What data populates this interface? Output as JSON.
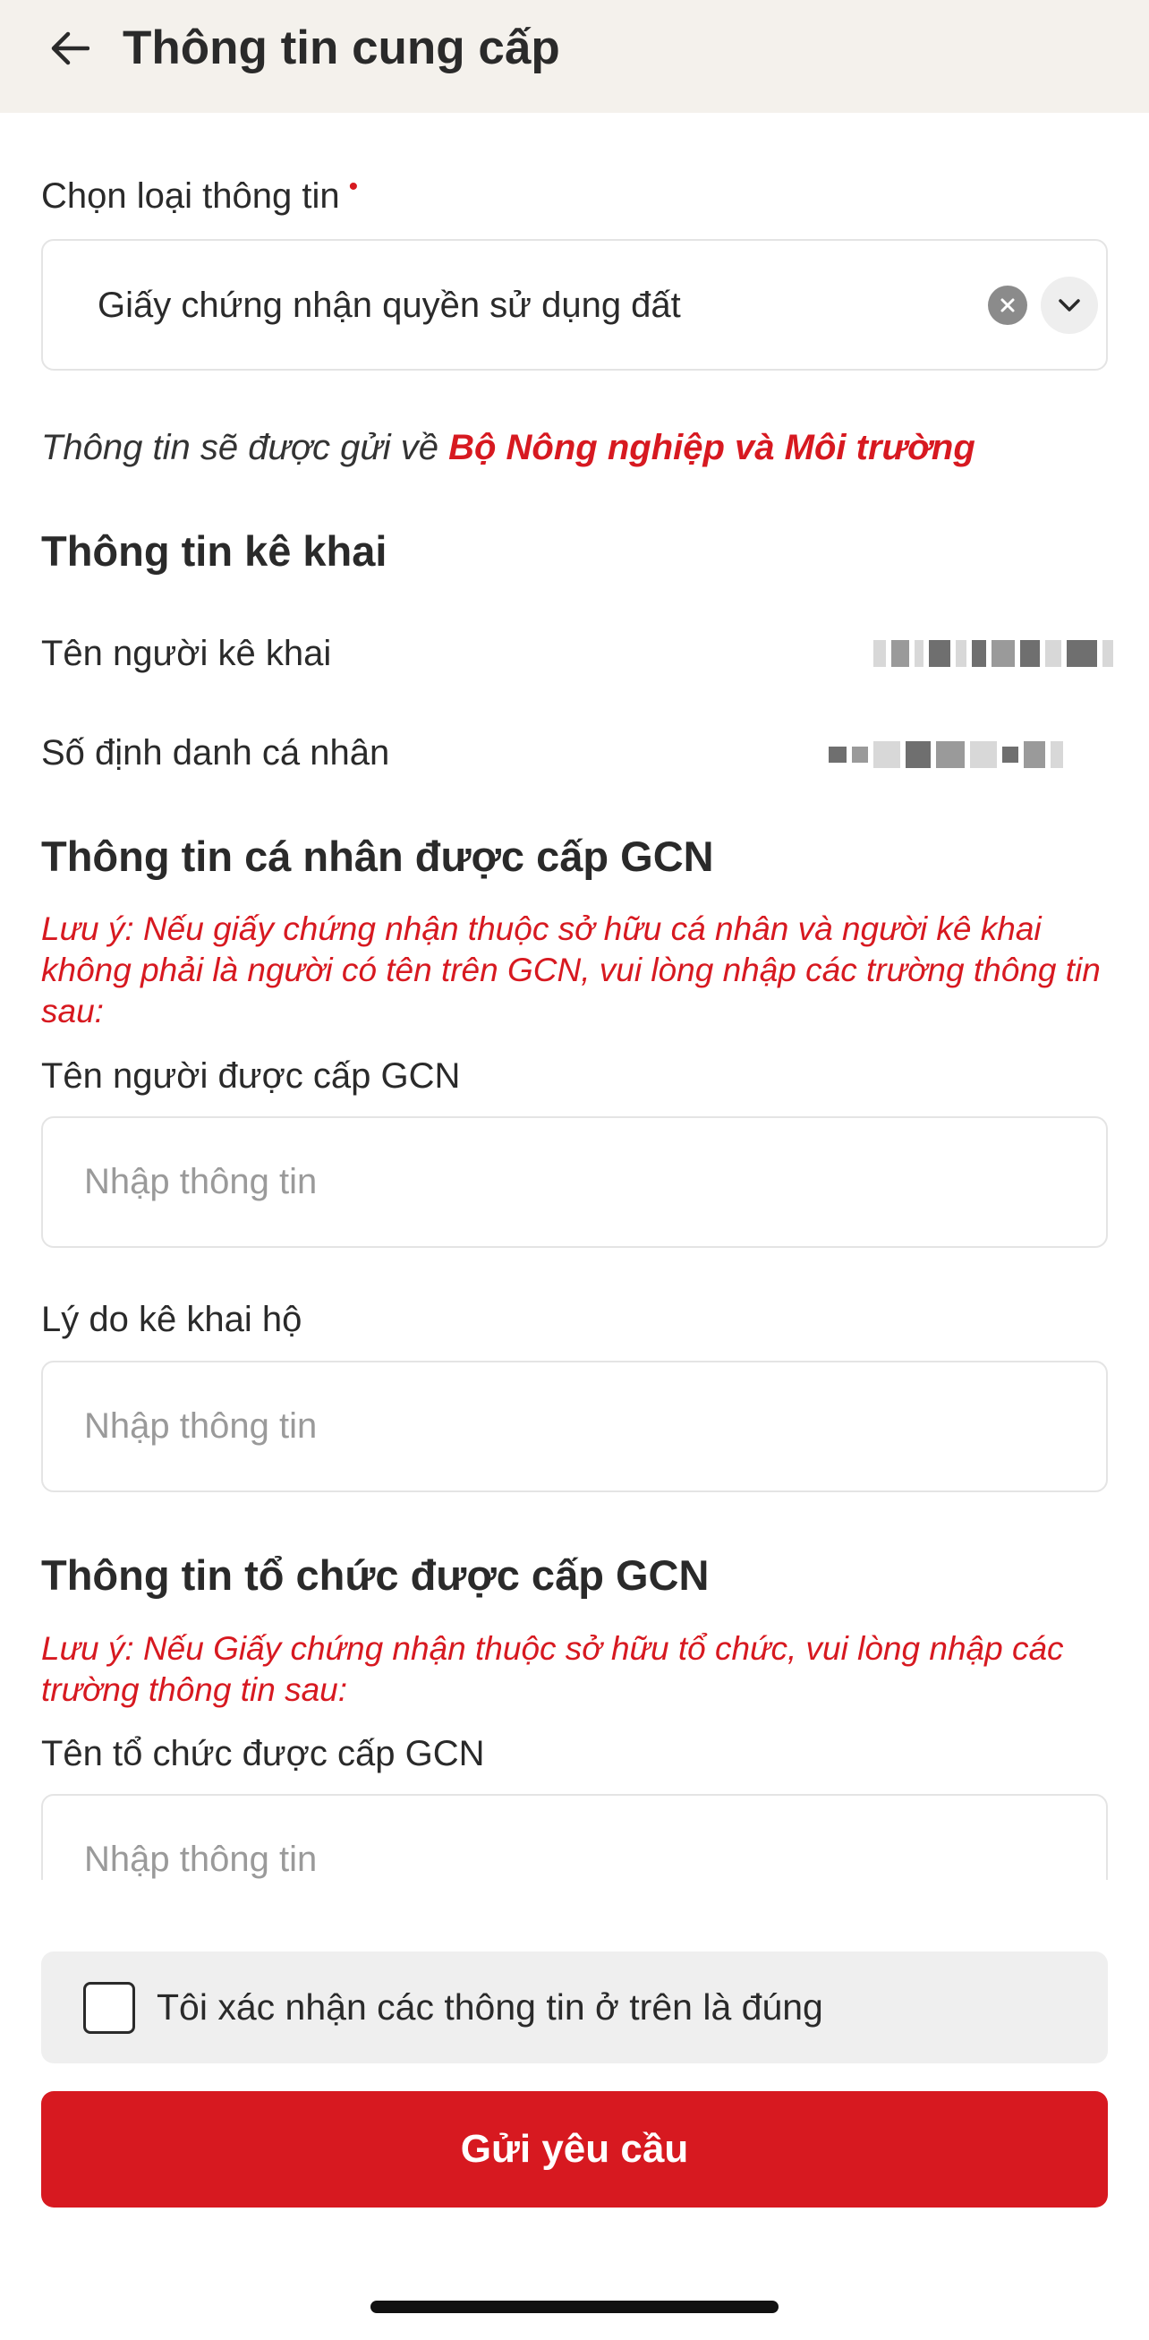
{
  "header": {
    "title": "Thông tin cung cấp"
  },
  "info_type": {
    "label": "Chọn loại thông tin",
    "required_marker": "•",
    "selected_value": "Giấy chứng nhận quyền sử dụng đất"
  },
  "send_note": {
    "prefix": "Thông tin sẽ được gửi về ",
    "department": "Bộ Nông nghiệp và Môi trường"
  },
  "declaration": {
    "title": "Thông tin kê khai",
    "declarant_name_label": "Tên người kê khai",
    "personal_id_label": "Số định danh cá nhân"
  },
  "individual": {
    "title": "Thông tin cá nhân được cấp GCN",
    "note": "Lưu ý: Nếu giấy chứng nhận thuộc sở hữu cá nhân và người kê khai không phải là người có tên trên GCN, vui lòng nhập các trường thông tin sau:",
    "holder_name_label": "Tên người được cấp GCN",
    "holder_name_placeholder": "Nhập thông tin",
    "reason_label": "Lý do kê khai hộ",
    "reason_placeholder": "Nhập thông tin"
  },
  "organization": {
    "title": "Thông tin tổ chức được cấp GCN",
    "note": "Lưu ý: Nếu Giấy chứng nhận thuộc sở hữu tổ chức, vui lòng nhập các trường thông tin sau:",
    "org_name_label": "Tên tổ chức được cấp GCN",
    "org_name_placeholder": "Nhập thông tin"
  },
  "confirm": {
    "label": "Tôi xác nhận các thông tin ở trên là đúng",
    "checked": false
  },
  "submit": {
    "label": "Gửi yêu cầu"
  },
  "colors": {
    "accent": "#d71920",
    "header_bg": "#f4f1ec"
  }
}
